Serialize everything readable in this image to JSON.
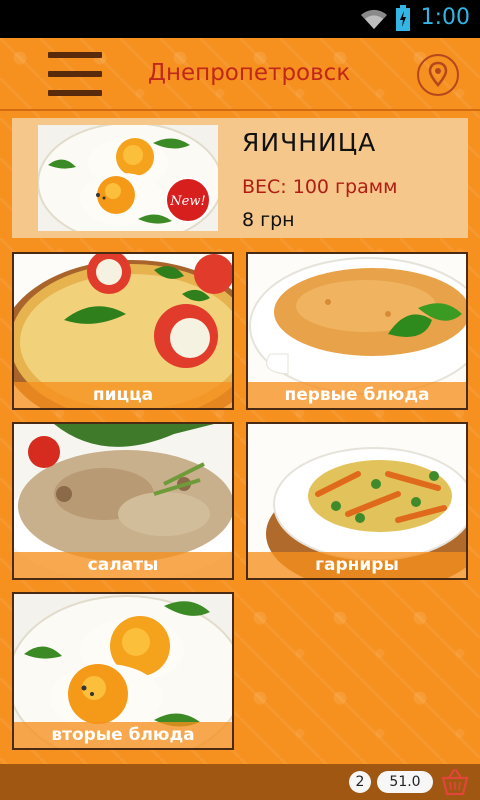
{
  "status_bar": {
    "time": "1:00"
  },
  "header": {
    "city": "Днепропетровск",
    "menu_icon": "hamburger-menu-icon",
    "location_icon": "location-pin-icon"
  },
  "featured": {
    "name": "ЯИЧНИЦА",
    "weight": "ВЕС: 100 грамм",
    "price": "8 грн",
    "badge": "New!"
  },
  "categories": [
    {
      "label": "пицца"
    },
    {
      "label": "первые блюда"
    },
    {
      "label": "салаты"
    },
    {
      "label": "гарниры"
    },
    {
      "label": "вторые блюда"
    }
  ],
  "cart": {
    "count": "2",
    "total": "51.0",
    "icon": "basket-icon"
  },
  "colors": {
    "background": "#f6901e",
    "accent": "#c0281a",
    "status_text": "#33b5e5",
    "bottom_bar": "#a05712"
  }
}
